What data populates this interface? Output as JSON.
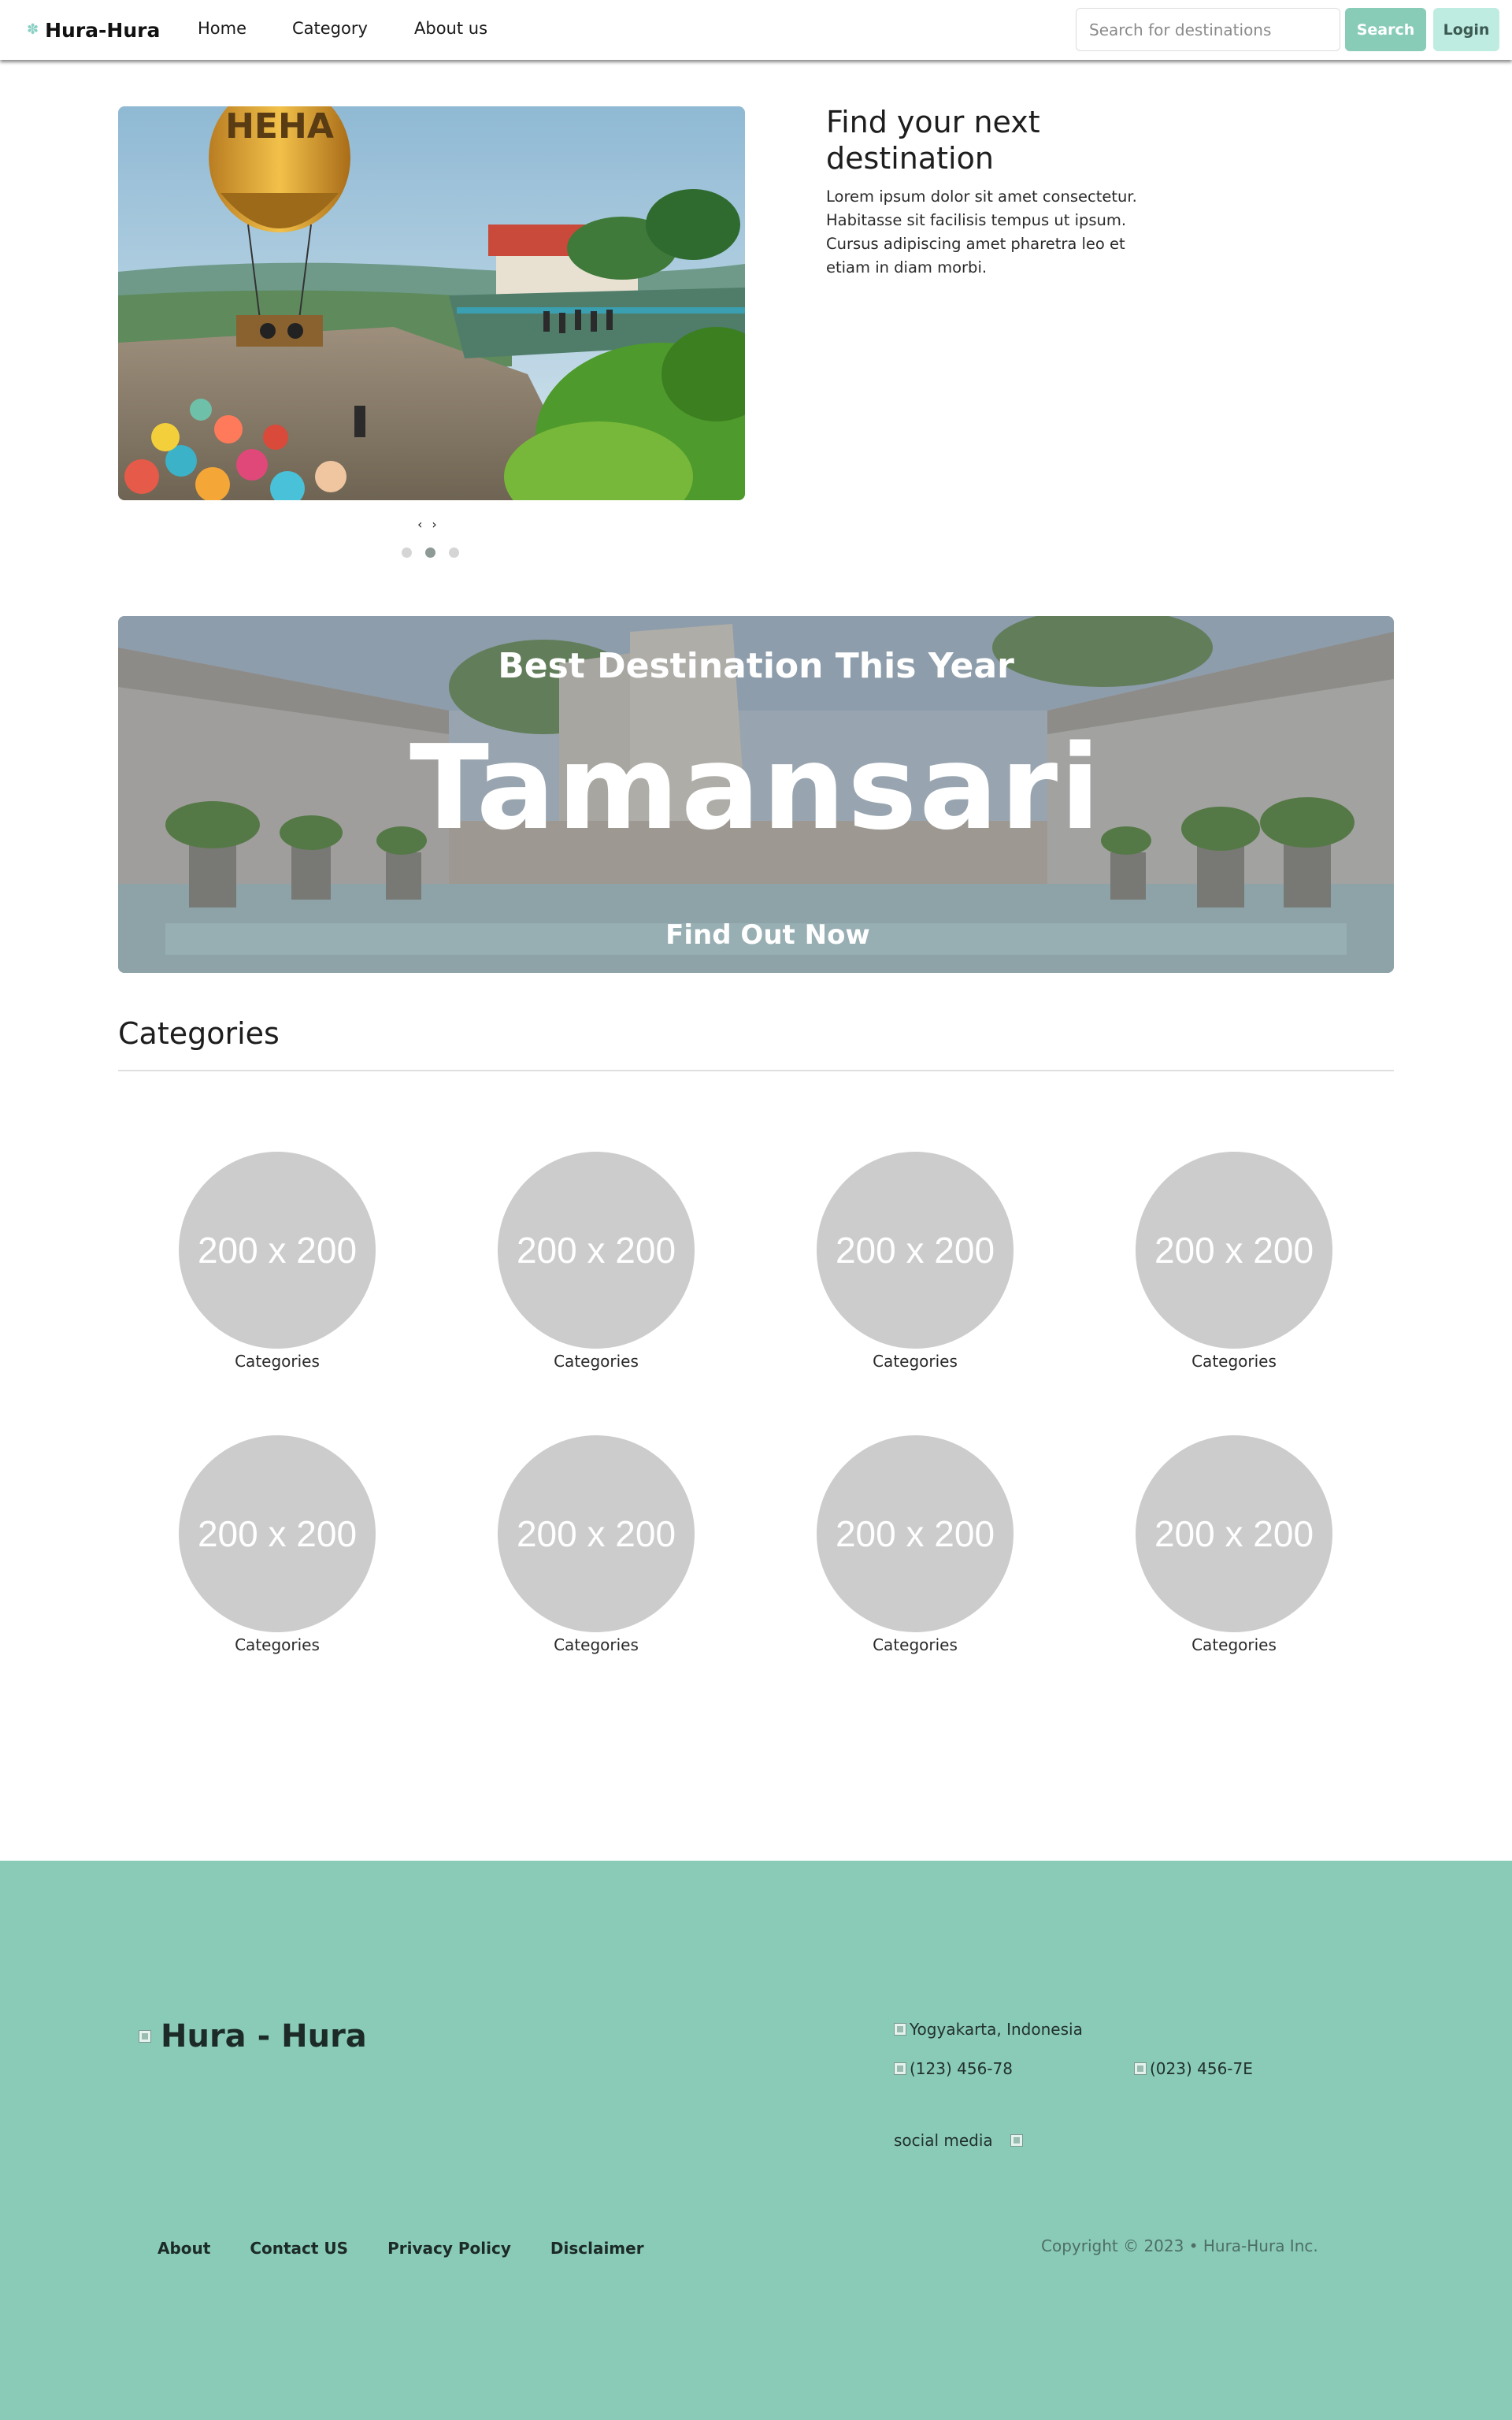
{
  "navbar": {
    "brand": "Hura-Hura",
    "links": [
      "Home",
      "Category",
      "About us"
    ],
    "search_placeholder": "Search for destinations",
    "search_label": "Search",
    "login_label": "Login"
  },
  "hero": {
    "title": "Find your next destination",
    "description": "Lorem ipsum dolor sit amet consectetur. Habitasse sit facilisis tempus ut ipsum. Cursus adipiscing amet pharetra leo et etiam in diam morbi.",
    "carousel": {
      "prev": "‹",
      "next": "›",
      "slide_count": 3,
      "active_slide": 2,
      "balloon_text": "HEHA"
    }
  },
  "banner": {
    "subtitle": "Best Destination This Year",
    "title": "Tamansari",
    "cta": "Find Out Now"
  },
  "categories": {
    "heading": "Categories",
    "placeholder_text": "200 x 200",
    "items": [
      "Categories",
      "Categories",
      "Categories",
      "Categories",
      "Categories",
      "Categories",
      "Categories",
      "Categories"
    ]
  },
  "footer": {
    "logo_text": "Hura - Hura",
    "location": "Yogyakarta, Indonesia",
    "phone_1": "(123) 456-78",
    "phone_2": "(023) 456-7E",
    "social_label": "social media",
    "links": [
      "About",
      "Contact US",
      "Privacy Policy",
      "Disclaimer"
    ],
    "copyright": "Copyright © 2023 • Hura-Hura Inc."
  },
  "colors": {
    "accent": "#88ccb8",
    "accent_light": "#bfece0",
    "footer_bg": "#89cbb6",
    "placeholder_gray": "#cccccc"
  }
}
